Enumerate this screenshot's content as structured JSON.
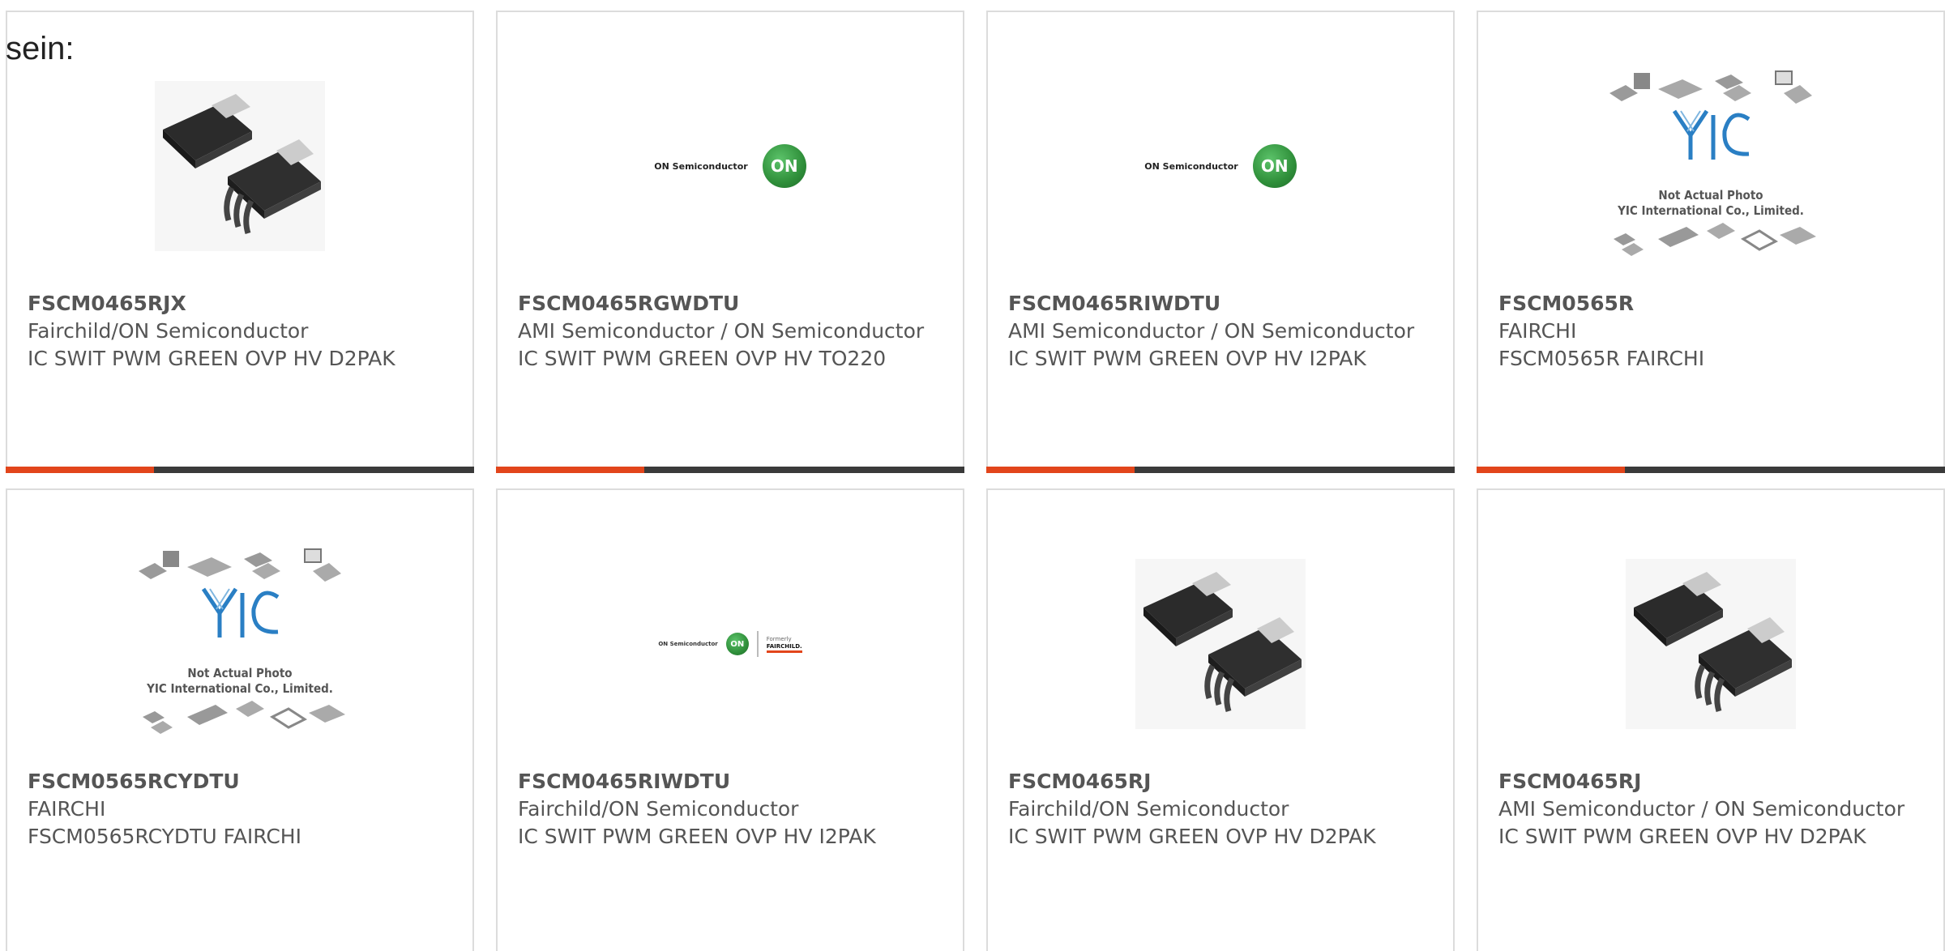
{
  "intro_text": "sein:",
  "colors": {
    "accent": "#e2451b",
    "bar": "#3a3a3a",
    "text": "#555555",
    "border": "#dcdcdc",
    "on_green": "#2f8f3a",
    "yic_blue": "#2a7fc4"
  },
  "cards": [
    {
      "part": "FSCM0465RJX",
      "manufacturer": "Fairchild/ON Semiconductor",
      "description": "IC SWIT PWM GREEN OVP HV D2PAK",
      "image": "d2pak-chip-photo"
    },
    {
      "part": "FSCM0465RGWDTU",
      "manufacturer": "AMI Semiconductor / ON Semiconductor",
      "description": "IC SWIT PWM GREEN OVP HV TO220",
      "image": "on-semiconductor-logo",
      "logo_text": "ON Semiconductor",
      "logo_mark": "ON"
    },
    {
      "part": "FSCM0465RIWDTU",
      "manufacturer": "AMI Semiconductor / ON Semiconductor",
      "description": "IC SWIT PWM GREEN OVP HV I2PAK",
      "image": "on-semiconductor-logo",
      "logo_text": "ON Semiconductor",
      "logo_mark": "ON"
    },
    {
      "part": "FSCM0565R",
      "manufacturer": "FAIRCHI",
      "description": "FSCM0565R FAIRCHI",
      "image": "yic-placeholder",
      "placeholder_line1": "Not Actual Photo",
      "placeholder_line2": "YIC International Co., Limited."
    },
    {
      "part": "FSCM0565RCYDTU",
      "manufacturer": "FAIRCHI",
      "description": "FSCM0565RCYDTU FAIRCHI",
      "image": "yic-placeholder",
      "placeholder_line1": "Not Actual Photo",
      "placeholder_line2": "YIC International Co., Limited."
    },
    {
      "part": "FSCM0465RIWDTU",
      "manufacturer": "Fairchild/ON Semiconductor",
      "description": "IC SWIT PWM GREEN OVP HV I2PAK",
      "image": "on-fairchild-logo",
      "logo_text": "ON Semiconductor",
      "logo_mark": "ON",
      "formerly_text": "Formerly",
      "fairchild_text": "FAIRCHILD."
    },
    {
      "part": "FSCM0465RJ",
      "manufacturer": "Fairchild/ON Semiconductor",
      "description": "IC SWIT PWM GREEN OVP HV D2PAK",
      "image": "d2pak-chip-photo"
    },
    {
      "part": "FSCM0465RJ",
      "manufacturer": "AMI Semiconductor / ON Semiconductor",
      "description": "IC SWIT PWM GREEN OVP HV D2PAK",
      "image": "d2pak-chip-photo"
    }
  ]
}
